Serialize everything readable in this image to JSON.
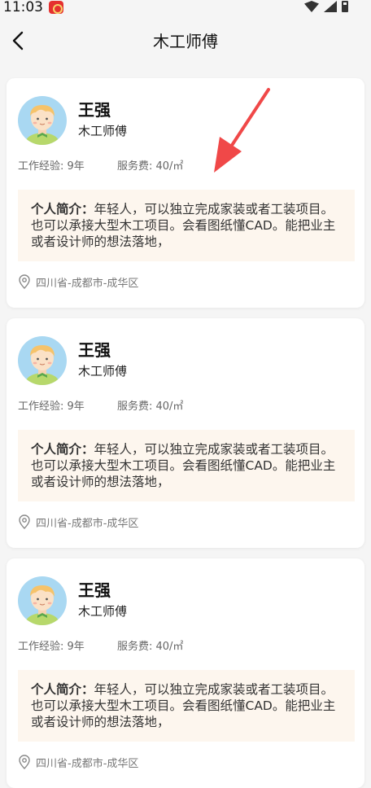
{
  "status_bar": {
    "time": "11:03"
  },
  "header": {
    "title": "木工师傅"
  },
  "workers": [
    {
      "name": "王强",
      "role": "木工师傅",
      "experience": "工作经验: 9年",
      "fee": "服务费: 40/㎡",
      "bio_label": "个人简介：",
      "bio_text": "年轻人，可以独立完成家装或者工装项目。也可以承接大型木工项目。会看图纸懂CAD。能把业主或者设计师的想法落地，",
      "location": "四川省-成都市-成华区"
    },
    {
      "name": "王强",
      "role": "木工师傅",
      "experience": "工作经验: 9年",
      "fee": "服务费: 40/㎡",
      "bio_label": "个人简介：",
      "bio_text": "年轻人，可以独立完成家装或者工装项目。也可以承接大型木工项目。会看图纸懂CAD。能把业主或者设计师的想法落地，",
      "location": "四川省-成都市-成华区"
    },
    {
      "name": "王强",
      "role": "木工师傅",
      "experience": "工作经验: 9年",
      "fee": "服务费: 40/㎡",
      "bio_label": "个人简介：",
      "bio_text": "年轻人，可以独立完成家装或者工装项目。也可以承接大型木工项目。会看图纸懂CAD。能把业主或者设计师的想法落地，",
      "location": "四川省-成都市-成华区"
    }
  ],
  "colors": {
    "page_bg": "#f5f5f5",
    "card_bg": "#ffffff",
    "bio_bg": "#fdf6ee",
    "annotation_arrow": "#f04848",
    "avatar_bg": "#a9d8f2"
  },
  "icons": {
    "back": "chevron-left-icon",
    "location": "map-pin-icon",
    "avatar": "worker-avatar-icon",
    "annotation": "red-arrow-icon"
  }
}
